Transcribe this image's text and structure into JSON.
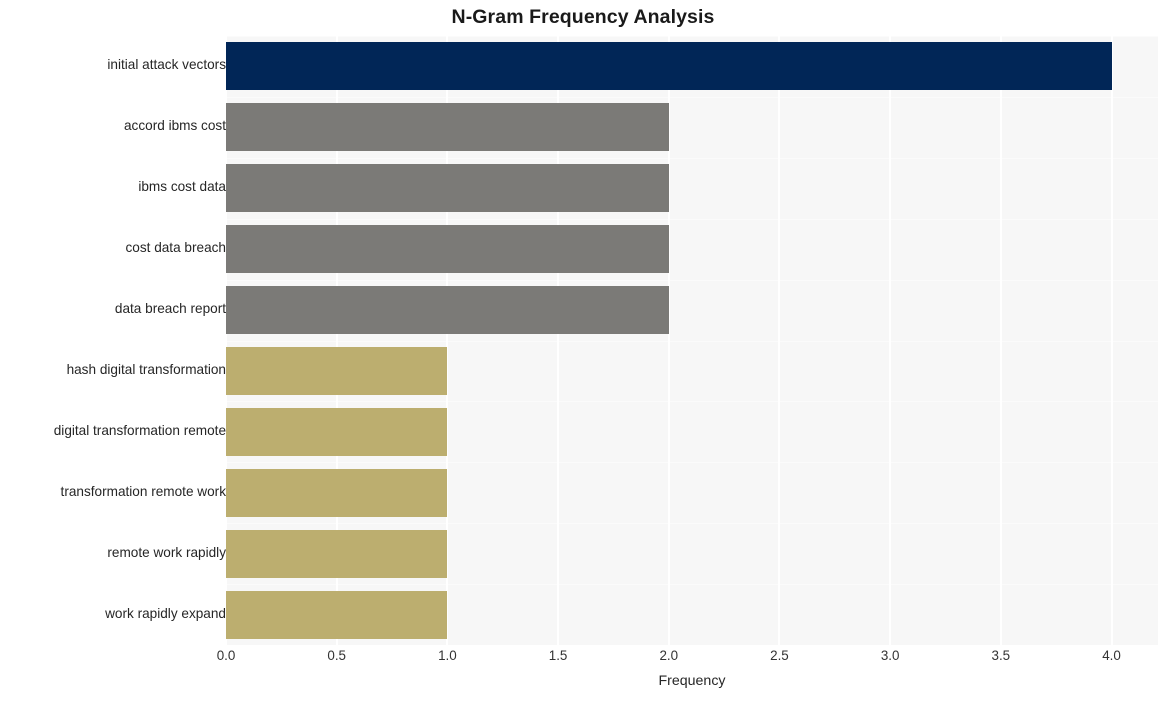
{
  "chart_data": {
    "type": "bar",
    "orientation": "horizontal",
    "title": "N-Gram Frequency Analysis",
    "xlabel": "Frequency",
    "ylabel": "",
    "categories": [
      "initial attack vectors",
      "accord ibms cost",
      "ibms cost data",
      "cost data breach",
      "data breach report",
      "hash digital transformation",
      "digital transformation remote",
      "transformation remote work",
      "remote work rapidly",
      "work rapidly expand"
    ],
    "values": [
      4,
      2,
      2,
      2,
      2,
      1,
      1,
      1,
      1,
      1
    ],
    "bar_colors": [
      "#012657",
      "#7b7a77",
      "#7b7a77",
      "#7b7a77",
      "#7b7a77",
      "#bcae6f",
      "#bcae6f",
      "#bcae6f",
      "#bcae6f",
      "#bcae6f"
    ],
    "xlim": [
      0.0,
      4.21
    ],
    "xticks": [
      0.0,
      0.5,
      1.0,
      1.5,
      2.0,
      2.5,
      3.0,
      3.5,
      4.0
    ],
    "xtick_labels": [
      "0.0",
      "0.5",
      "1.0",
      "1.5",
      "2.0",
      "2.5",
      "3.0",
      "3.5",
      "4.0"
    ],
    "grid": "vertical-and-horizontal",
    "legend": "none",
    "plot_background": "#f7f7f7",
    "figure_background": "#ffffff",
    "gridline_color": "#ffffff",
    "title_color": "#1a1a1a",
    "tick_label_color": "#262626"
  }
}
